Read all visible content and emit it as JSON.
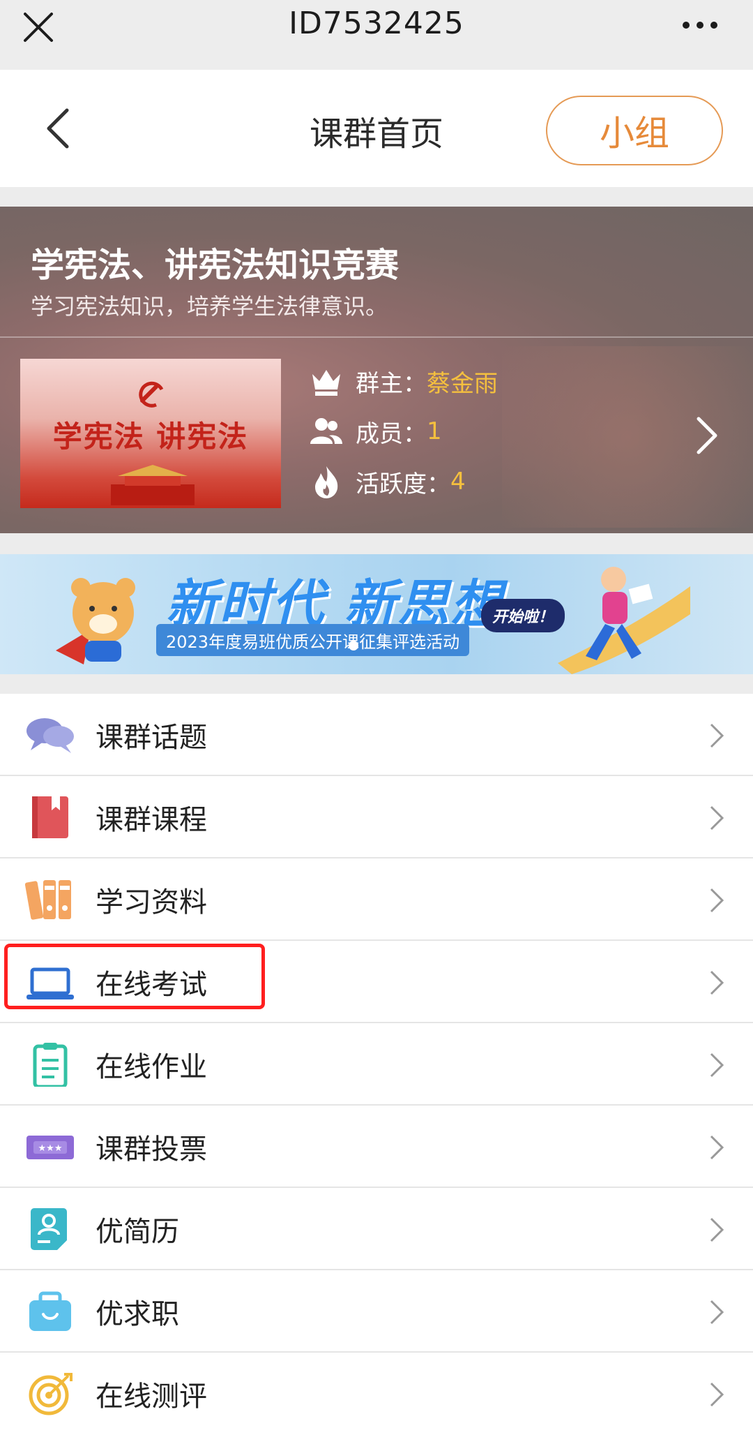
{
  "topbar": {
    "title": "ID7532425",
    "close_icon": "close-icon",
    "more_icon": "more-dots-icon"
  },
  "header": {
    "title": "课群首页",
    "back_icon": "chevron-left-icon",
    "group_button": "小组",
    "accent": "#e68a3a"
  },
  "group": {
    "name": "学宪法、讲宪法知识竞赛",
    "description": "学习宪法知识，培养学生法律意识。",
    "cover_text": "学宪法  讲宪法",
    "owner_label": "群主：",
    "owner_value": "蔡金雨",
    "members_label": "成员：",
    "members_value": "1",
    "activity_label": "活跃度：",
    "activity_value": "4",
    "highlight_color": "#f5c03e"
  },
  "banner": {
    "slogan": "新时代 新思想",
    "subtitle": "2023年度易班优质公开课征集评选活动",
    "start_badge": "开始啦！"
  },
  "menu": [
    {
      "label": "课群话题",
      "icon": "chat-bubbles-icon"
    },
    {
      "label": "课群课程",
      "icon": "book-icon"
    },
    {
      "label": "学习资料",
      "icon": "binders-icon"
    },
    {
      "label": "在线考试",
      "icon": "laptop-icon"
    },
    {
      "label": "在线作业",
      "icon": "clipboard-icon"
    },
    {
      "label": "课群投票",
      "icon": "ticket-icon"
    },
    {
      "label": "优简历",
      "icon": "resume-icon"
    },
    {
      "label": "优求职",
      "icon": "briefcase-icon"
    },
    {
      "label": "在线测评",
      "icon": "target-icon"
    }
  ],
  "highlight_box_color": "#ff1f1f"
}
